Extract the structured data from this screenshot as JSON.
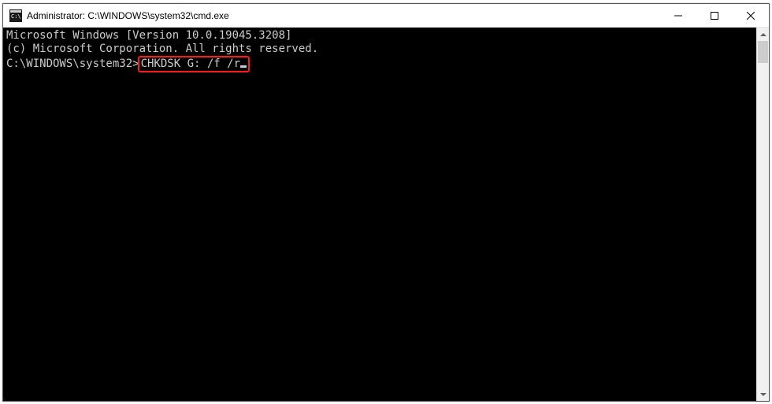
{
  "window": {
    "title": "Administrator: C:\\WINDOWS\\system32\\cmd.exe"
  },
  "terminal": {
    "line1": "Microsoft Windows [Version 10.0.19045.3208]",
    "line2": "(c) Microsoft Corporation. All rights reserved.",
    "blank": "",
    "prompt": "C:\\WINDOWS\\system32>",
    "command": "CHKDSK G: /f /r"
  },
  "highlight": {
    "color": "#ff1a1a"
  }
}
